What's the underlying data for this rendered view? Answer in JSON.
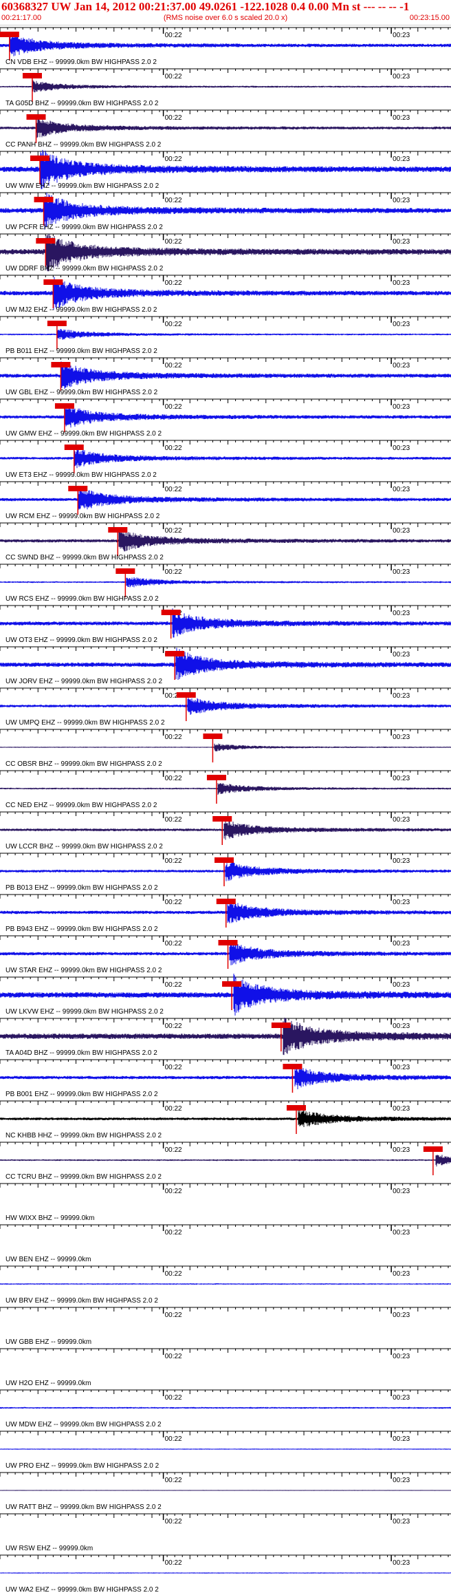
{
  "header": {
    "title": "60368327 UW Jan 14, 2012 00:21:37.00   49.0261 -122.1028  0.4 0.00 Mn st --- -- --  -1",
    "start_time": "00:21:17.00",
    "scale_note": "(RMS noise over 6.0 s scaled 20.0 x)",
    "end_time": "00:23:15.00"
  },
  "colors": {
    "header_red": "#e00000",
    "trace_blue": "#1010e8",
    "trace_navy": "#2a1660",
    "trace_black": "#000000",
    "pick_red": "#e00000"
  },
  "chart_data": {
    "type": "seismogram",
    "time_axis": {
      "start": "00:21:17.00",
      "end": "00:23:15.00",
      "unit": "s",
      "minute_labels": [
        "00:22",
        "00:23"
      ],
      "minute_offsets_s": [
        43,
        103
      ]
    },
    "traces": [
      {
        "label": "CN VDB EHZ -- 99999.0km BW  HIGHPASS  2.0  2",
        "pick_s": 2.5,
        "color": "blue",
        "amp": 0.6
      },
      {
        "label": "TA G05D BHZ -- 99999.0km BW  HIGHPASS  2.0  2",
        "pick_s": 8.5,
        "color": "navy",
        "amp": 0.3
      },
      {
        "label": "CC PANH BHZ -- 99999.0km BW  HIGHPASS  2.0  2",
        "pick_s": 9.5,
        "color": "navy",
        "amp": 0.5
      },
      {
        "label": "UW WIW EHZ -- 99999.0km BW  HIGHPASS  2.0  2",
        "pick_s": 10.5,
        "color": "blue",
        "amp": 1.0
      },
      {
        "label": "UW PCFR EHZ -- 99999.0km BW  HIGHPASS  2.0  2",
        "pick_s": 11.5,
        "color": "blue",
        "amp": 0.9
      },
      {
        "label": "UW DDRF BHZ -- 99999.0km BW  HIGHPASS  2.0  2",
        "pick_s": 12.0,
        "color": "navy",
        "amp": 1.0
      },
      {
        "label": "UW MJ2 EHZ -- 99999.0km BW  HIGHPASS  2.0  2",
        "pick_s": 14.0,
        "color": "blue",
        "amp": 0.8
      },
      {
        "label": "PB B011 EHZ -- 99999.0km BW  HIGHPASS  2.0  2",
        "pick_s": 15.0,
        "color": "blue",
        "amp": 0.3
      },
      {
        "label": "UW GBL EHZ -- 99999.0km BW  HIGHPASS  2.0  2",
        "pick_s": 16.0,
        "color": "blue",
        "amp": 0.7
      },
      {
        "label": "UW GMW EHZ -- 99999.0km BW  HIGHPASS  2.0  2",
        "pick_s": 17.0,
        "color": "blue",
        "amp": 0.6
      },
      {
        "label": "UW ET3 EHZ -- 99999.0km BW  HIGHPASS  2.0  2",
        "pick_s": 19.5,
        "color": "blue",
        "amp": 0.5
      },
      {
        "label": "UW RCM EHZ -- 99999.0km BW  HIGHPASS  2.0  2",
        "pick_s": 20.5,
        "color": "blue",
        "amp": 0.6
      },
      {
        "label": "CC SWND BHZ -- 99999.0km BW  HIGHPASS  2.0  2",
        "pick_s": 31.0,
        "color": "navy",
        "amp": 0.6
      },
      {
        "label": "UW RCS EHZ -- 99999.0km BW  HIGHPASS  2.0  2",
        "pick_s": 33.0,
        "color": "blue",
        "amp": 0.3
      },
      {
        "label": "UW OT3 EHZ -- 99999.0km BW  HIGHPASS  2.0  2",
        "pick_s": 45.0,
        "color": "blue",
        "amp": 0.7
      },
      {
        "label": "UW JORV EHZ -- 99999.0km BW  HIGHPASS  2.0  2",
        "pick_s": 46.0,
        "color": "blue",
        "amp": 0.8
      },
      {
        "label": "UW UMPQ EHZ -- 99999.0km BW  HIGHPASS  2.0  2",
        "pick_s": 49.0,
        "color": "blue",
        "amp": 0.5
      },
      {
        "label": "CC OBSR BHZ -- 99999.0km BW  HIGHPASS  2.0  2",
        "pick_s": 56.0,
        "color": "navy",
        "amp": 0.2
      },
      {
        "label": "CC NED EHZ -- 99999.0km BW  HIGHPASS  2.0  2",
        "pick_s": 57.0,
        "color": "navy",
        "amp": 0.3
      },
      {
        "label": "UW LCCR BHZ -- 99999.0km BW  HIGHPASS  2.0  2",
        "pick_s": 58.5,
        "color": "navy",
        "amp": 0.5
      },
      {
        "label": "PB B013 EHZ -- 99999.0km BW  HIGHPASS  2.0  2",
        "pick_s": 59.0,
        "color": "blue",
        "amp": 0.5
      },
      {
        "label": "PB B943 EHZ -- 99999.0km BW  HIGHPASS  2.0  2",
        "pick_s": 59.5,
        "color": "blue",
        "amp": 0.6
      },
      {
        "label": "UW STAR EHZ -- 99999.0km BW  HIGHPASS  2.0  2",
        "pick_s": 60.0,
        "color": "blue",
        "amp": 0.6
      },
      {
        "label": "UW LKVW EHZ -- 99999.0km BW  HIGHPASS  2.0  2",
        "pick_s": 61.0,
        "color": "blue",
        "amp": 1.0
      },
      {
        "label": "TA A04D BHZ -- 99999.0km BW  HIGHPASS  2.0  2",
        "pick_s": 74.0,
        "color": "navy",
        "amp": 1.0
      },
      {
        "label": "PB B001 EHZ -- 99999.0km BW  HIGHPASS  2.0  2",
        "pick_s": 77.0,
        "color": "blue",
        "amp": 0.6
      },
      {
        "label": "NC KHBB HHZ -- 99999.0km BW  HIGHPASS  2.0  2",
        "pick_s": 78.0,
        "color": "black",
        "amp": 0.5
      },
      {
        "label": "CC TCRU BHZ -- 99999.0km BW  HIGHPASS  2.0  2",
        "pick_s": 114.0,
        "color": "navy",
        "amp": 0.3
      },
      {
        "label": "HW WIXX BHZ -- 99999.0km",
        "pick_s": null,
        "color": "none",
        "amp": 0
      },
      {
        "label": "UW BEN EHZ -- 99999.0km",
        "pick_s": null,
        "color": "none",
        "amp": 0
      },
      {
        "label": "UW BRV EHZ -- 99999.0km BW  HIGHPASS  2.0  2",
        "pick_s": null,
        "color": "blue",
        "amp": 0.25
      },
      {
        "label": "UW GBB EHZ -- 99999.0km",
        "pick_s": null,
        "color": "none",
        "amp": 0
      },
      {
        "label": "UW H2O EHZ -- 99999.0km",
        "pick_s": null,
        "color": "none",
        "amp": 0
      },
      {
        "label": "UW MDW EHZ -- 99999.0km BW  HIGHPASS  2.0  2",
        "pick_s": null,
        "color": "blue",
        "amp": 0.3
      },
      {
        "label": "UW PRO EHZ -- 99999.0km BW  HIGHPASS  2.0  2",
        "pick_s": null,
        "color": "blue",
        "amp": 0.2
      },
      {
        "label": "UW RATT BHZ -- 99999.0km BW  HIGHPASS  2.0  2",
        "pick_s": null,
        "color": "navy",
        "amp": 0.15
      },
      {
        "label": "UW RSW EHZ -- 99999.0km",
        "pick_s": null,
        "color": "none",
        "amp": 0
      },
      {
        "label": "UW WA2 EHZ -- 99999.0km BW  HIGHPASS  2.0  2",
        "pick_s": null,
        "color": "blue",
        "amp": 0.2
      }
    ]
  }
}
